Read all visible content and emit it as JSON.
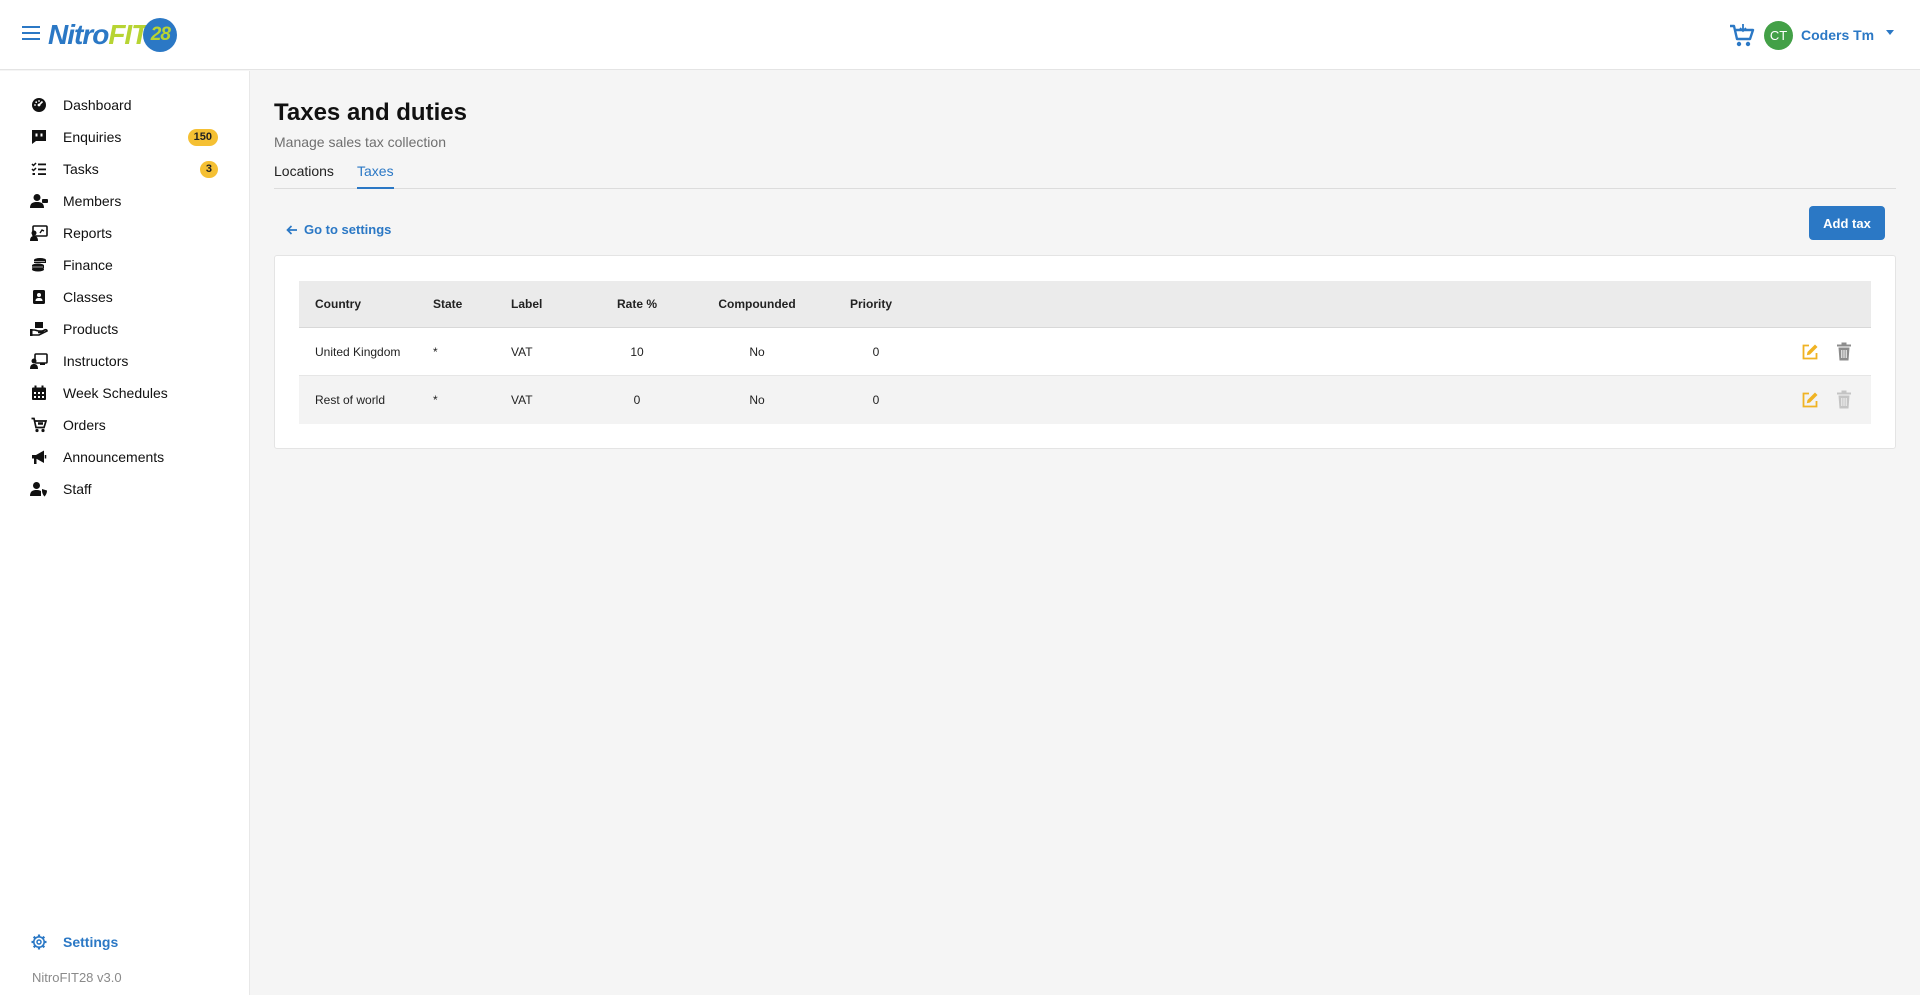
{
  "header": {
    "logo": {
      "part1": "Nitro",
      "part2": "FIT",
      "part3": "28"
    },
    "user": {
      "initials": "CT",
      "name": "Coders Tm"
    },
    "colors": {
      "accent": "#2b78c5",
      "avatar": "#43a047",
      "logo_green": "#b7d433"
    }
  },
  "sidebar": {
    "items": [
      {
        "label": "Dashboard",
        "icon": "dashboard-icon"
      },
      {
        "label": "Enquiries",
        "icon": "enquiries-icon",
        "badge": "150"
      },
      {
        "label": "Tasks",
        "icon": "tasks-icon",
        "badge": "3"
      },
      {
        "label": "Members",
        "icon": "members-icon"
      },
      {
        "label": "Reports",
        "icon": "reports-icon"
      },
      {
        "label": "Finance",
        "icon": "finance-icon"
      },
      {
        "label": "Classes",
        "icon": "classes-icon"
      },
      {
        "label": "Products",
        "icon": "products-icon"
      },
      {
        "label": "Instructors",
        "icon": "instructors-icon"
      },
      {
        "label": "Week Schedules",
        "icon": "calendar-icon"
      },
      {
        "label": "Orders",
        "icon": "cart-icon"
      },
      {
        "label": "Announcements",
        "icon": "megaphone-icon"
      },
      {
        "label": "Staff",
        "icon": "staff-icon"
      }
    ],
    "settings_label": "Settings",
    "version": "NitroFIT28 v3.0",
    "badge_color": "#f5c033"
  },
  "main": {
    "title": "Taxes and duties",
    "subtitle": "Manage sales tax collection",
    "tabs": [
      {
        "label": "Locations"
      },
      {
        "label": "Taxes",
        "active": true
      }
    ],
    "back_link": "Go to settings",
    "add_button": "Add tax",
    "table": {
      "headers": [
        "Country",
        "State",
        "Label",
        "Rate %",
        "Compounded",
        "Priority"
      ],
      "rows": [
        {
          "country": "United Kingdom",
          "state": "*",
          "label": "VAT",
          "rate": "10",
          "compounded": "No",
          "priority": "0"
        },
        {
          "country": "Rest of world",
          "state": "*",
          "label": "VAT",
          "rate": "0",
          "compounded": "No",
          "priority": "0"
        }
      ]
    },
    "action_colors": {
      "edit": "#f0b323",
      "delete": "#8c8c8c"
    }
  }
}
